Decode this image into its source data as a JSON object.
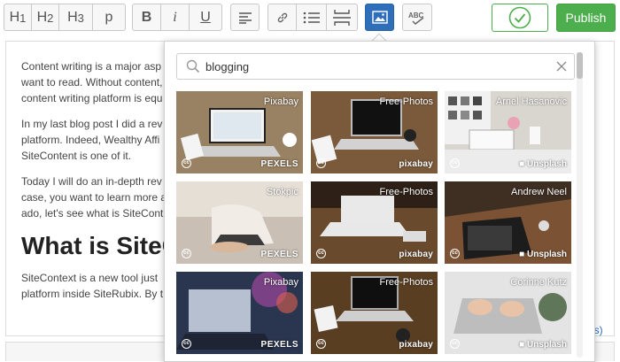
{
  "toolbar": {
    "headings": [
      "H",
      "H",
      "H"
    ],
    "heading_nums": [
      "1",
      "2",
      "3"
    ],
    "paragraph": "p",
    "bold": "B",
    "italic": "i",
    "underline": "U",
    "publish_label": "Publish",
    "colors": {
      "accent": "#2f6fba",
      "publish": "#4cae4c"
    }
  },
  "article": {
    "p1_line1": "Content writing is a major asp",
    "p1_line2": "want to read. Without content,",
    "p1_line3": "content writing platform is equ",
    "p2_line1": "In my last blog post I did a rev",
    "p2_line2": "platform. Indeed, Wealthy Affi",
    "p2_line3": "SiteContent is one of it.",
    "p3_line1": "Today I will do an in-depth rev",
    "p3_line2": "case, you want to learn more a",
    "p3_line3": "ado, let's see what is SiteCont",
    "heading": "What is SiteC",
    "p4_line1": "SiteContext is a new tool just",
    "p4_line2": "platform inside SiteRubix. By t",
    "side_fragment": "ns)"
  },
  "picker": {
    "search_value": "blogging",
    "images": [
      {
        "source": "Pixabay",
        "brand": "PEXELS",
        "bg": "#8a7358"
      },
      {
        "source": "Free-Photos",
        "brand": "pixabay",
        "bg": "#7a5a3a"
      },
      {
        "source": "Arnel Hasanovic",
        "brand": "Unsplash",
        "bg": "#d9d6d0"
      },
      {
        "source": "Stokpic",
        "brand": "PEXELS",
        "bg": "#c9bfb4"
      },
      {
        "source": "Free-Photos",
        "brand": "pixabay",
        "bg": "#6a4a2c"
      },
      {
        "source": "Andrew Neel",
        "brand": "Unsplash",
        "bg": "#3f2e22"
      },
      {
        "source": "Pixabay",
        "brand": "PEXELS",
        "bg": "#2a3550"
      },
      {
        "source": "Free-Photos",
        "brand": "pixabay",
        "bg": "#5a3e22"
      },
      {
        "source": "Corinne Kutz",
        "brand": "Unsplash",
        "bg": "#cfcfcf"
      }
    ]
  }
}
